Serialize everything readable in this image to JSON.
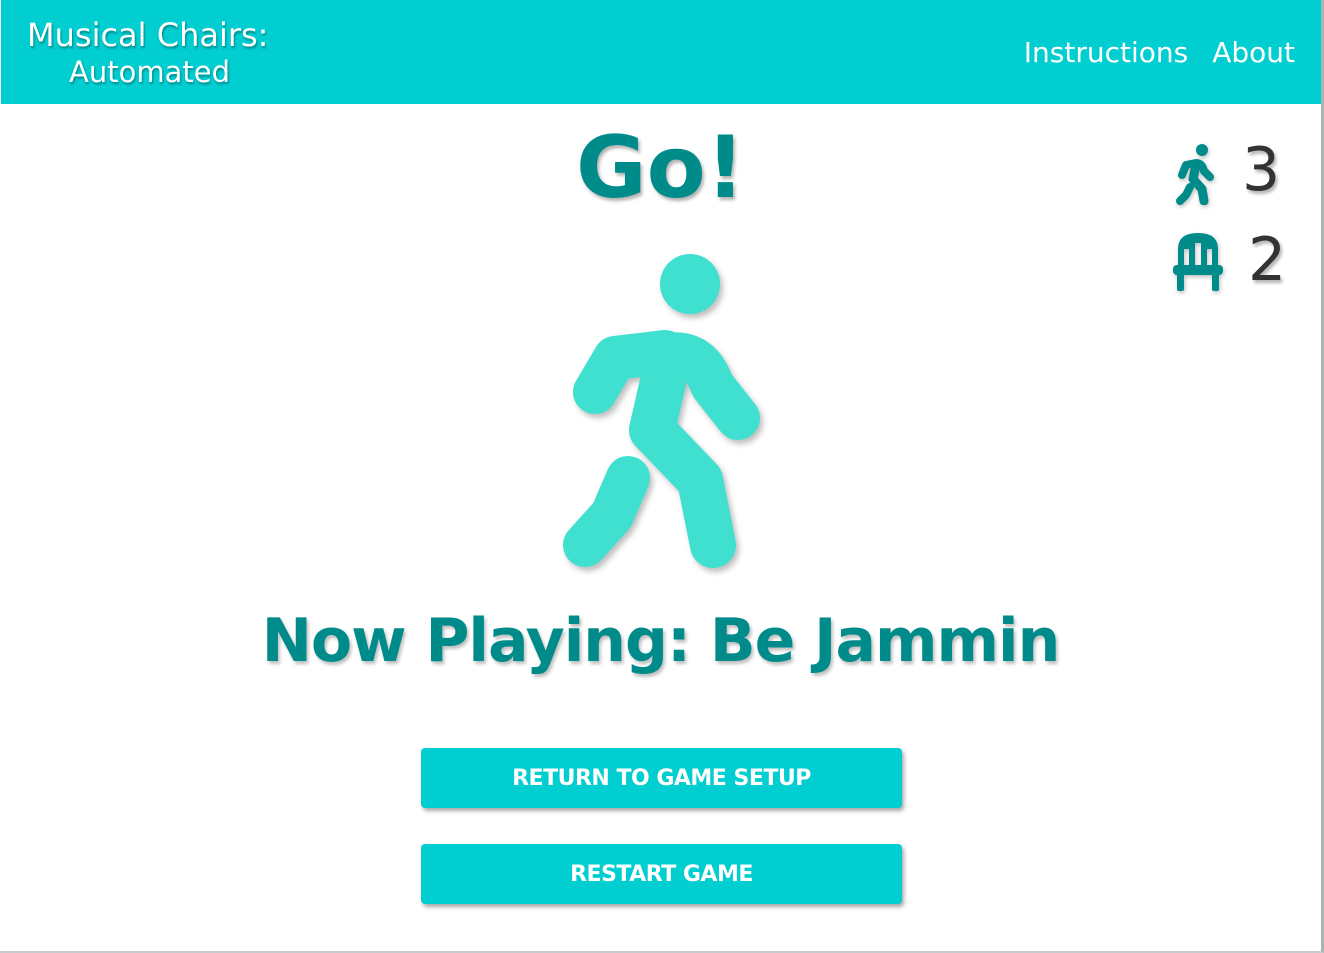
{
  "header": {
    "title_line1": "Musical Chairs:",
    "title_line2": "Automated",
    "nav": [
      "Instructions",
      "About"
    ]
  },
  "status": {
    "heading": "Go!",
    "now_playing": "Now Playing: Be Jammin"
  },
  "counts": {
    "players": "3",
    "chairs": "2",
    "player_icon": "walking-person-icon",
    "chair_icon": "chair-icon"
  },
  "buttons": {
    "return_setup": "RETURN TO GAME SETUP",
    "restart": "RESTART GAME"
  },
  "colors": {
    "accent": "#00ced1",
    "dark_teal": "#008b8b",
    "figure": "#40e0d0"
  }
}
